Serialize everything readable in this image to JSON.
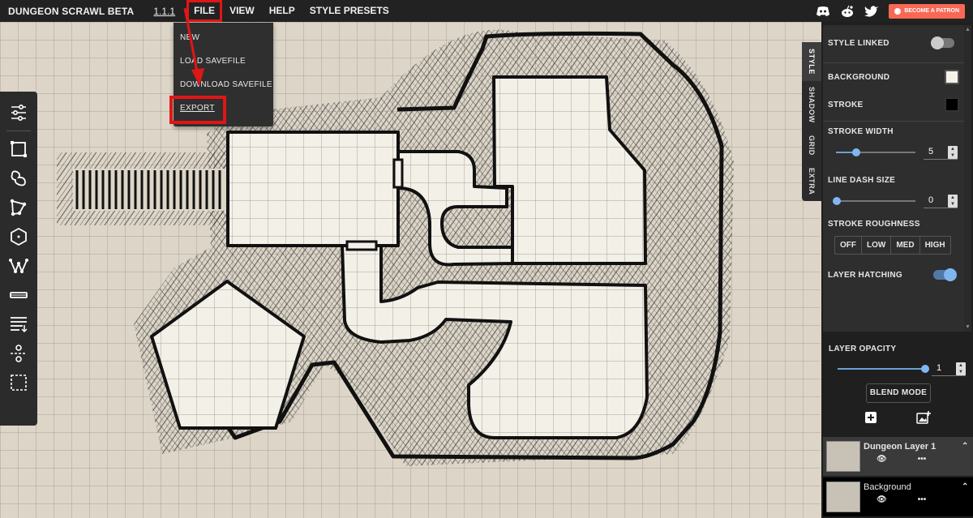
{
  "menubar": {
    "app_title": "DUNGEON SCRAWL BETA",
    "version": "1.1.1",
    "menus": [
      "FILE",
      "VIEW",
      "HELP",
      "STYLE PRESETS"
    ],
    "patron_button": "BECOME A PATRON",
    "social_icons": [
      "discord-icon",
      "reddit-icon",
      "twitter-icon"
    ]
  },
  "file_menu": {
    "items": [
      "NEW",
      "LOAD SAVEFILE",
      "DOWNLOAD SAVEFILE",
      "EXPORT"
    ],
    "highlighted": "EXPORT"
  },
  "toolbar": {
    "tools": [
      "style-settings-icon",
      "rectangle-tool-icon",
      "freeform-shape-icon",
      "polygon-tool-icon",
      "hexagon-tool-icon",
      "path-tool-icon",
      "door-tool-icon",
      "stairs-tool-icon",
      "split-tool-icon",
      "select-tool-icon"
    ]
  },
  "side_tabs": [
    "STYLE",
    "SHADOW",
    "GRID",
    "EXTRA"
  ],
  "style_panel": {
    "style_linked_label": "STYLE LINKED",
    "style_linked": false,
    "background_label": "BACKGROUND",
    "background_color": "#f5f2ea",
    "stroke_label": "STROKE",
    "stroke_color": "#000000",
    "stroke_width_label": "STROKE WIDTH",
    "stroke_width_value": "5",
    "line_dash_label": "LINE DASH SIZE",
    "line_dash_value": "0",
    "roughness_label": "STROKE ROUGHNESS",
    "roughness_options": [
      "OFF",
      "LOW",
      "MED",
      "HIGH"
    ],
    "hatching_label": "LAYER HATCHING",
    "hatching": true
  },
  "layer_panel": {
    "opacity_label": "LAYER OPACITY",
    "opacity_value": "1",
    "blend_mode_label": "BLEND MODE",
    "layers": [
      {
        "name": "Dungeon Layer 1"
      },
      {
        "name": "Background"
      }
    ]
  },
  "colors": {
    "accent": "#7fb6f0",
    "highlight": "#e01616",
    "patron": "#f96854"
  }
}
